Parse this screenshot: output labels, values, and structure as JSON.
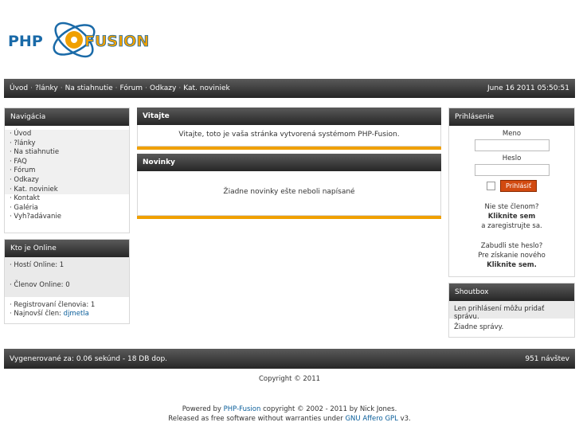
{
  "logo": {
    "text_left": "PHP",
    "text_right": "FUSION",
    "colors": {
      "blue": "#1a6aa8",
      "orange": "#f0a000"
    }
  },
  "topbar": {
    "nav": [
      "Úvod",
      "?lánky",
      "Na stiahnutie",
      "Fórum",
      "Odkazy",
      "Kat. noviniek"
    ],
    "datetime": "June 16 2011 05:50:51"
  },
  "navigation": {
    "title": "Navigácia",
    "items": [
      "Úvod",
      "?lánky",
      "Na stiahnutie",
      "FAQ",
      "Fórum",
      "Odkazy",
      "Kat. noviniek",
      "Kontakt",
      "Galéria",
      "Vyh?adávanie"
    ]
  },
  "online": {
    "title": "Kto je Online",
    "guests": "Hostí Online: 1",
    "members": "Členov Online: 0",
    "registered": "Registrovaní členovia: 1",
    "newest_label": "Najnovší člen:",
    "newest_user": "djmetla"
  },
  "welcome": {
    "title": "Vitajte",
    "text": "Vitajte, toto je vaša stránka vytvorená systémom PHP-Fusion."
  },
  "news": {
    "title": "Novinky",
    "text": "Žiadne novinky ešte neboli napísané"
  },
  "login": {
    "title": "Prihlásenie",
    "username_label": "Meno",
    "password_label": "Heslo",
    "submit": "Prihlásiť",
    "not_member": "Nie ste členom?",
    "click_here": "Kliknite sem",
    "to_register": "a zaregistrujte sa.",
    "forgot": "Zabudli ste heslo?",
    "recover": "Pre získanie nového",
    "click_here2": "Kliknite sem."
  },
  "shoutbox": {
    "title": "Shoutbox",
    "notice": "Len prihlásení môžu pridať správu.",
    "empty": "Žiadne správy."
  },
  "footer": {
    "render": "Vygenerované za: 0.06 sekúnd - 18 DB dop.",
    "visits": "951 návštev",
    "copyright": "Copyright © 2011",
    "powered_pre": "Powered by",
    "powered_link": "PHP-Fusion",
    "powered_post": "copyright © 2002 - 2011 by Nick Jones.",
    "license_pre": "Released as free software without warranties under",
    "license_link": "GNU Affero GPL",
    "license_post": "v3."
  }
}
